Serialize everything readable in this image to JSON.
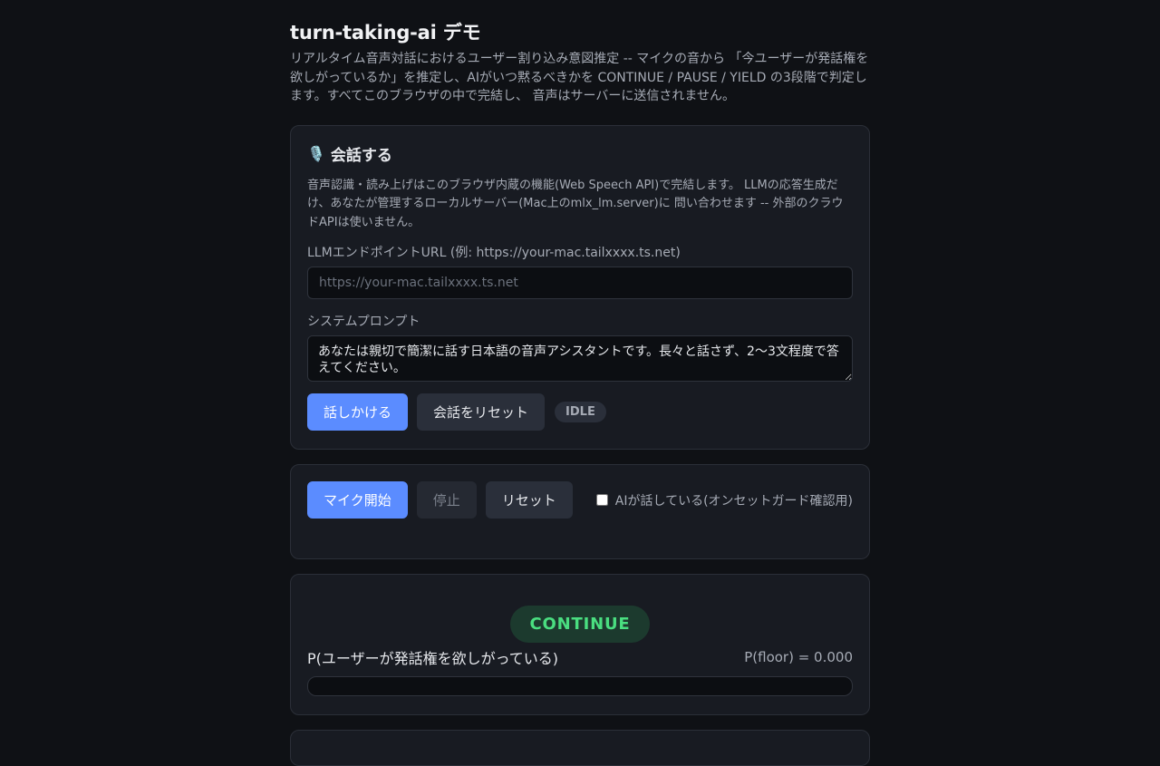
{
  "header": {
    "title": "turn-taking-ai デモ",
    "description": "リアルタイム音声対話におけるユーザー割り込み意図推定 -- マイクの音から 「今ユーザーが発話権を欲しがっているか」を推定し、AIがいつ黙るべきかを CONTINUE / PAUSE / YIELD の3段階で判定します。すべてこのブラウザの中で完結し、 音声はサーバーに送信されません。"
  },
  "conversation": {
    "title": "会話する",
    "icon": "microphone-icon",
    "description": "音声認識・読み上げはこのブラウザ内蔵の機能(Web Speech API)で完結します。 LLMの応答生成だけ、あなたが管理するローカルサーバー(Mac上のmlx_lm.server)に 問い合わせます -- 外部のクラウドAPIは使いません。",
    "endpoint_label": "LLMエンドポイントURL (例: https://your-mac.tailxxxx.ts.net)",
    "endpoint_value": "",
    "endpoint_placeholder": "https://your-mac.tailxxxx.ts.net",
    "prompt_label": "システムプロンプト",
    "prompt_value": "あなたは親切で簡潔に話す日本語の音声アシスタントです。長々と話さず、2〜3文程度で答えてください。",
    "talk_button": "話しかける",
    "reset_button": "会話をリセット",
    "status": "IDLE"
  },
  "mic": {
    "start_button": "マイク開始",
    "stop_button": "停止",
    "reset_button": "リセット",
    "ai_speaking_label": "AIが話している(オンセットガード確認用)",
    "ai_speaking_checked": false
  },
  "decision": {
    "state": "CONTINUE",
    "state_color": "#4ade80",
    "prob_label": "P(ユーザーが発話権を欲しがっている)",
    "prob_text": "P(floor) = 0.000",
    "prob_value": 0.0
  }
}
